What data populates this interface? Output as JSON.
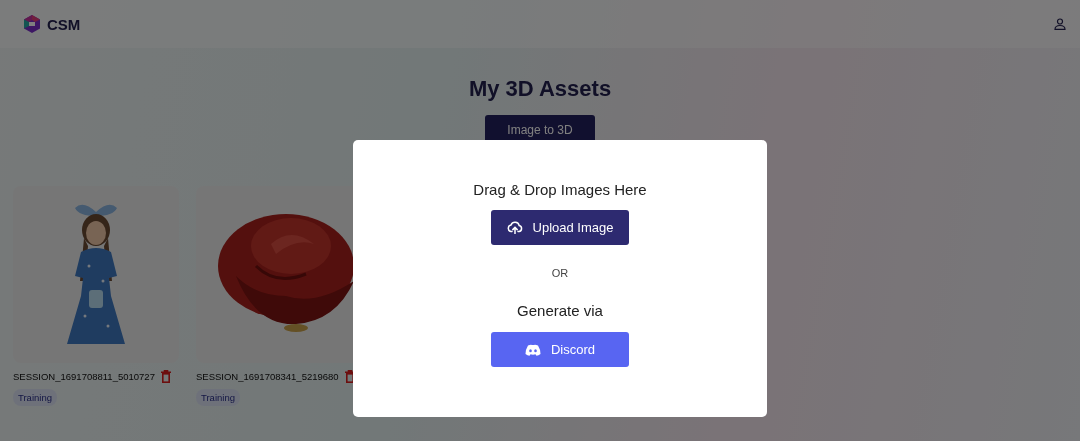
{
  "header": {
    "logo_text": "CSM"
  },
  "page": {
    "title": "My 3D Assets",
    "action_button": "Image to 3D"
  },
  "assets": [
    {
      "name": "SESSION_1691708811_5010727",
      "status": "Training"
    },
    {
      "name": "SESSION_1691708341_5219680",
      "status": "Training"
    }
  ],
  "modal": {
    "drop_text": "Drag & Drop Images Here",
    "upload_button": "Upload Image",
    "separator": "OR",
    "generate_text": "Generate via",
    "discord_button": "Discord"
  }
}
